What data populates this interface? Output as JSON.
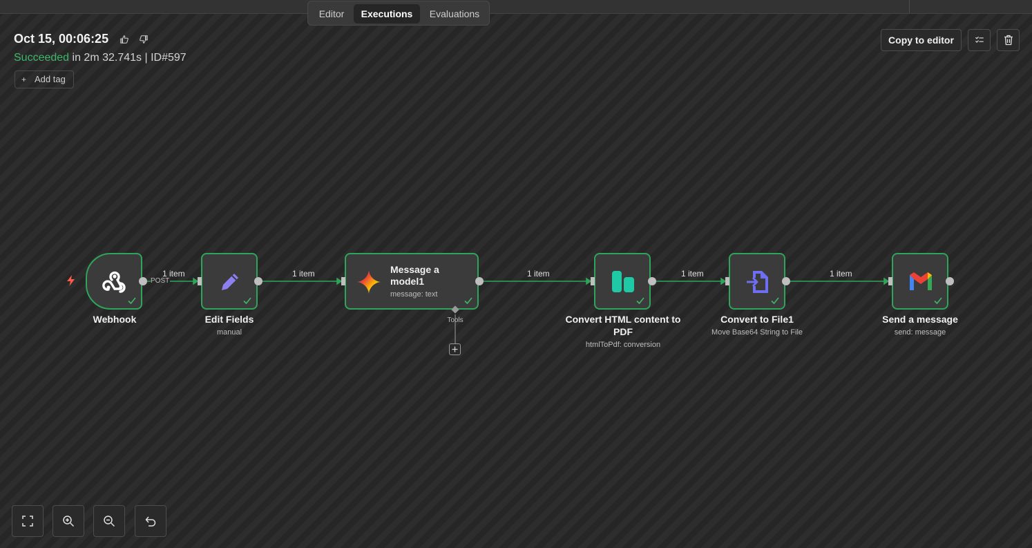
{
  "tabs": [
    {
      "label": "Editor",
      "active": false
    },
    {
      "label": "Executions",
      "active": true
    },
    {
      "label": "Evaluations",
      "active": false
    }
  ],
  "execution": {
    "date": "Oct 15, 00:06:25",
    "status": "Succeeded",
    "duration": "in 2m 32.741s",
    "id": "| ID#597",
    "add_tag": "Add tag"
  },
  "actions": {
    "copy_to_editor": "Copy to editor"
  },
  "nodes": [
    {
      "label": "Webhook",
      "sub": "",
      "icon": "webhook-icon"
    },
    {
      "label": "Edit Fields",
      "sub": "manual",
      "icon": "pencil-icon"
    },
    {
      "label": "Message a model1",
      "sub": "message: text",
      "icon": "gemini-icon"
    },
    {
      "label": "Convert HTML content to PDF",
      "sub": "htmlToPdf: conversion",
      "icon": "pdf-convert-icon"
    },
    {
      "label": "Convert to File1",
      "sub": "Move Base64 String to File",
      "icon": "file-convert-icon"
    },
    {
      "label": "Send a message",
      "sub": "send: message",
      "icon": "gmail-icon"
    }
  ],
  "connections": {
    "item_counts": [
      "1 item",
      "1 item",
      "1 item",
      "1 item",
      "1 item"
    ],
    "webhook_method": "POST",
    "tools_label": "Tools"
  },
  "colors": {
    "success": "#3fb76a",
    "node_border": "#2fa55b",
    "edit_fields": "#8c7ff0",
    "pdf": "#1fc9a5",
    "file": "#6e6ef2",
    "trigger": "#ff5a4a"
  }
}
